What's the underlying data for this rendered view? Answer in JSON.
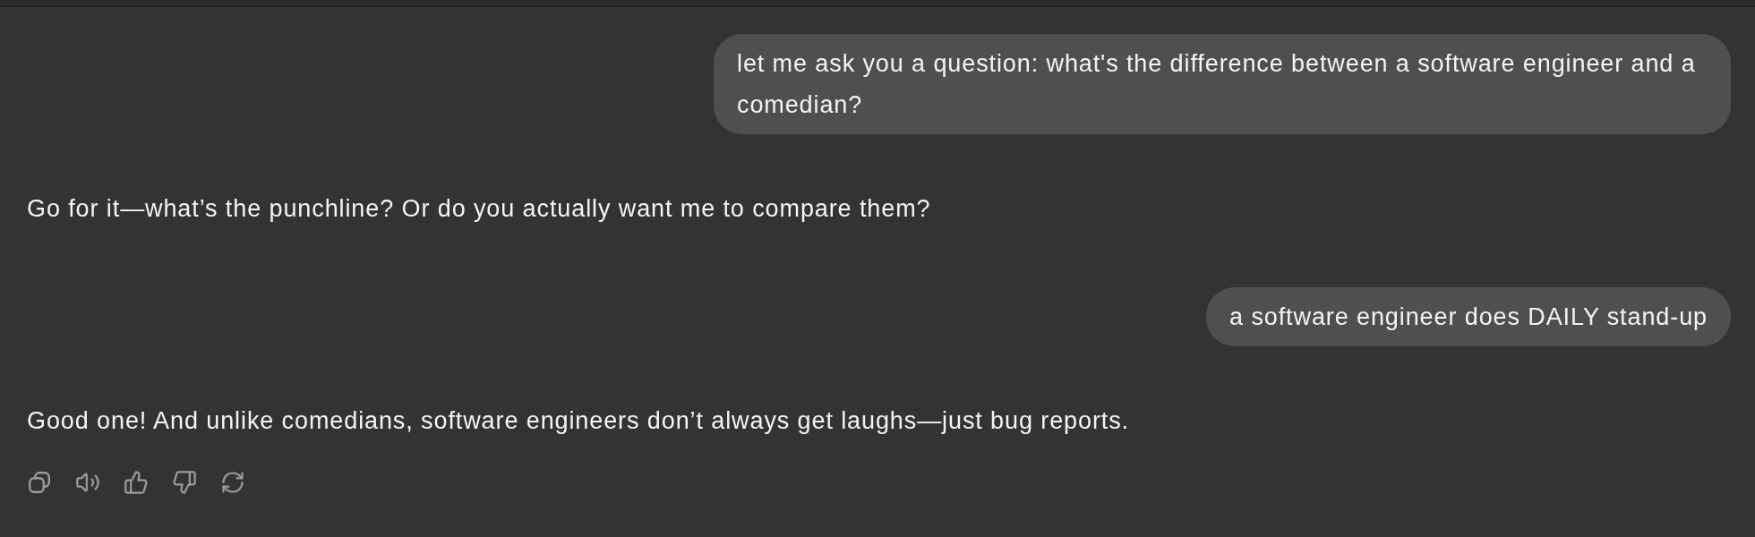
{
  "messages": [
    {
      "kind": "user",
      "text": "let me ask you a question: what's the difference between a software engineer and a comedian?"
    },
    {
      "kind": "assistant",
      "text": "Go for it—what’s the punchline? Or do you actually want me to compare them?"
    },
    {
      "kind": "user",
      "text": "a software engineer does DAILY stand-up"
    },
    {
      "kind": "assistant",
      "text": "Good one! And unlike comedians, software engineers don’t always get laughs—just bug reports.",
      "actions": [
        {
          "kind": "copy"
        },
        {
          "kind": "read_aloud"
        },
        {
          "kind": "like"
        },
        {
          "kind": "dislike"
        },
        {
          "kind": "regenerate"
        }
      ]
    }
  ]
}
